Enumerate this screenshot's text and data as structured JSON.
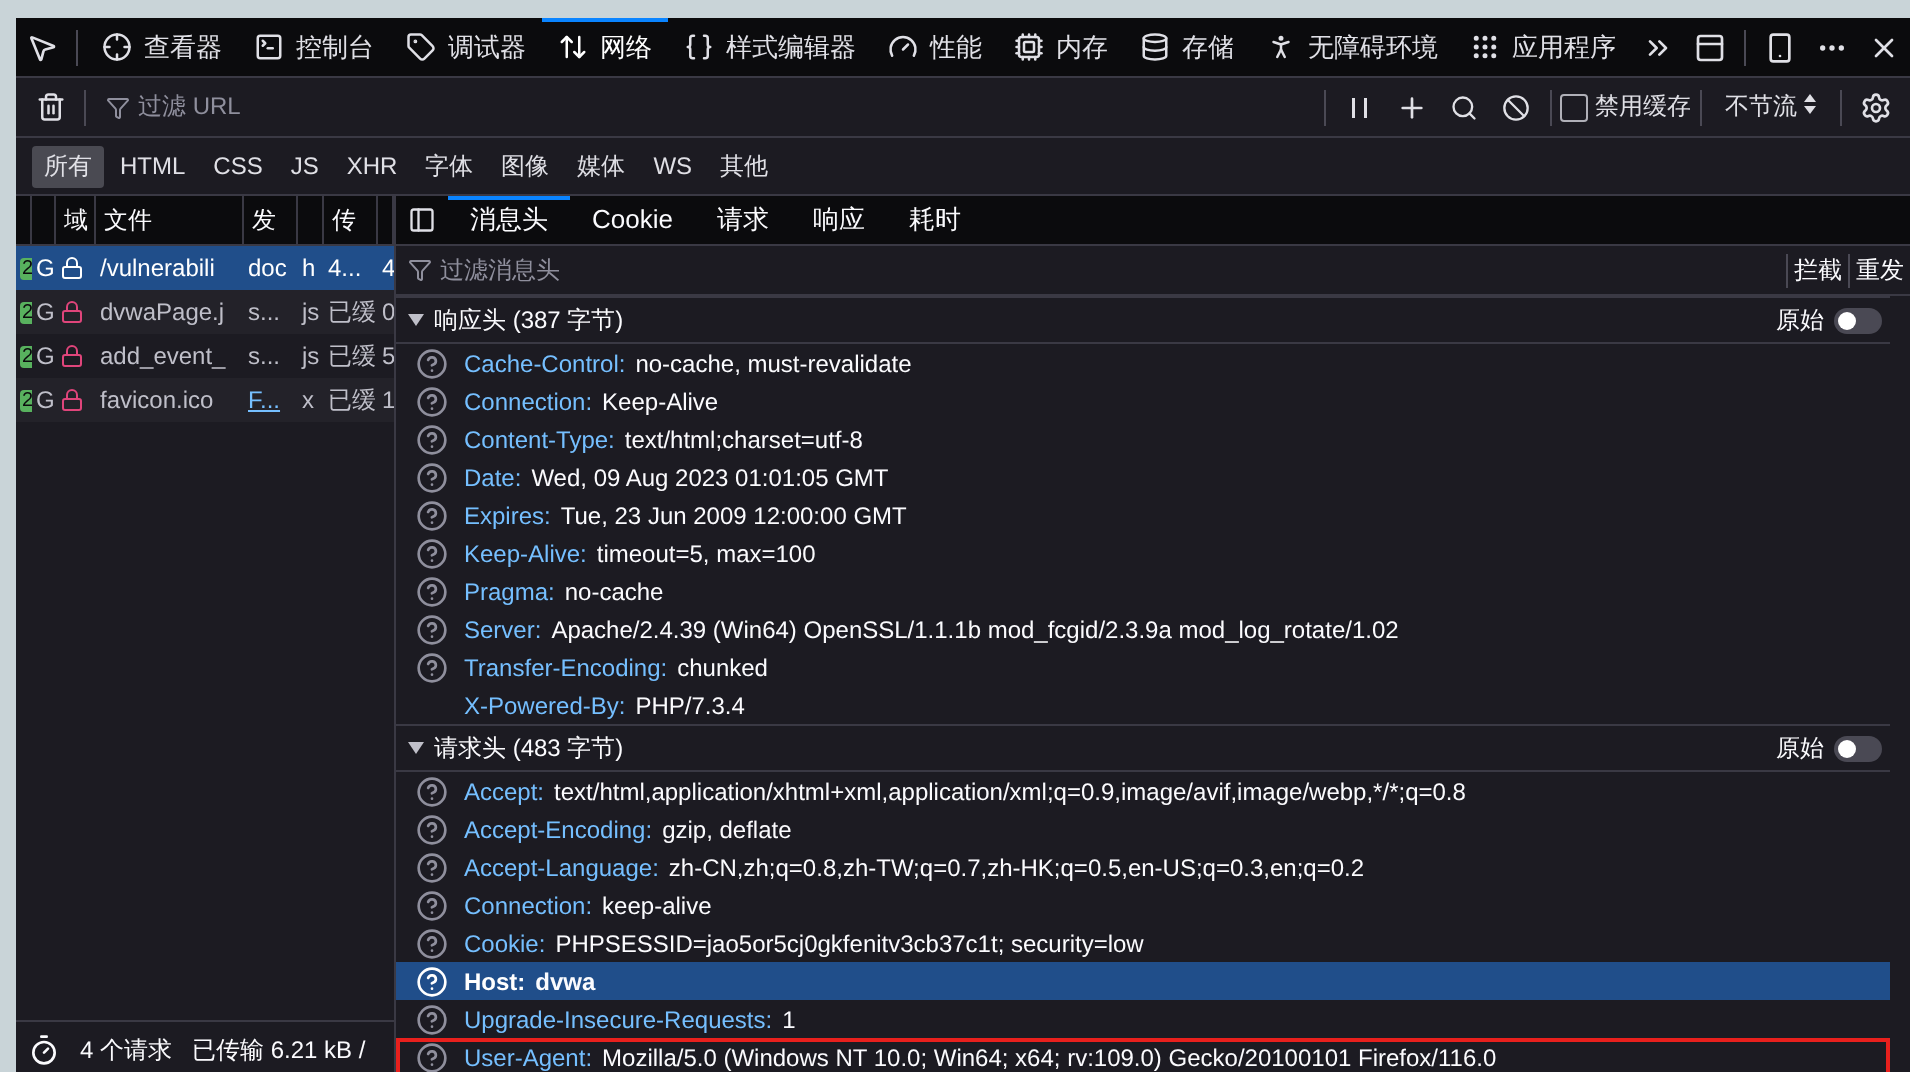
{
  "toolbar": {
    "tabs": [
      {
        "label": "查看器",
        "selected": false
      },
      {
        "label": "控制台",
        "selected": false
      },
      {
        "label": "调试器",
        "selected": false
      },
      {
        "label": "网络",
        "selected": true
      },
      {
        "label": "样式编辑器",
        "selected": false
      },
      {
        "label": "性能",
        "selected": false
      },
      {
        "label": "内存",
        "selected": false
      },
      {
        "label": "存储",
        "selected": false
      },
      {
        "label": "无障碍环境",
        "selected": false
      },
      {
        "label": "应用程序",
        "selected": false
      }
    ]
  },
  "network_toolbar": {
    "filter": {
      "placeholder": "过滤 URL"
    },
    "disable_cache": {
      "label": "禁用缓存",
      "checked": false
    },
    "throttle": "不节流"
  },
  "type_filters": [
    {
      "label": "所有",
      "selected": true
    },
    {
      "label": "HTML",
      "selected": false
    },
    {
      "label": "CSS",
      "selected": false
    },
    {
      "label": "JS",
      "selected": false
    },
    {
      "label": "XHR",
      "selected": false
    },
    {
      "label": "字体",
      "selected": false
    },
    {
      "label": "图像",
      "selected": false
    },
    {
      "label": "媒体",
      "selected": false
    },
    {
      "label": "WS",
      "selected": false
    },
    {
      "label": "其他",
      "selected": false
    }
  ],
  "requests": {
    "columns": [
      "域",
      "文件",
      "发",
      "传"
    ],
    "rows": [
      {
        "status": "2",
        "method": "G",
        "file": "/vulnerabili",
        "initiator": "doc",
        "initiator_link": false,
        "type": "h",
        "transferred": "4...",
        "size": "4",
        "selected": true
      },
      {
        "status": "2",
        "method": "G",
        "file": "dvwaPage.j",
        "initiator": "s...",
        "initiator_link": false,
        "type": "js",
        "transferred": "已缓",
        "size": "0",
        "selected": false
      },
      {
        "status": "2",
        "method": "G",
        "file": "add_event_",
        "initiator": "s...",
        "initiator_link": false,
        "type": "js",
        "transferred": "已缓",
        "size": "5",
        "selected": false
      },
      {
        "status": "2",
        "method": "G",
        "file": "favicon.ico",
        "initiator": "F...",
        "initiator_link": true,
        "type": "x",
        "transferred": "已缓",
        "size": "1",
        "selected": false
      }
    ]
  },
  "status_bar": {
    "requests": "4 个请求",
    "transferred": "已传输 6.21 kB /"
  },
  "details": {
    "tabs": [
      {
        "label": "消息头",
        "selected": true
      },
      {
        "label": "Cookie",
        "selected": false
      },
      {
        "label": "请求",
        "selected": false
      },
      {
        "label": "响应",
        "selected": false
      },
      {
        "label": "耗时",
        "selected": false
      }
    ],
    "filter": {
      "placeholder": "过滤消息头"
    },
    "actions": [
      "拦截",
      "重发"
    ],
    "sections": [
      {
        "title": "响应头 (387 字节)",
        "raw_label": "原始",
        "raw_on": false,
        "headers": [
          {
            "name": "Cache-Control:",
            "value": "no-cache, must-revalidate",
            "help": true,
            "selected": false,
            "highlighted": false
          },
          {
            "name": "Connection:",
            "value": "Keep-Alive",
            "help": true,
            "selected": false,
            "highlighted": false
          },
          {
            "name": "Content-Type:",
            "value": "text/html;charset=utf-8",
            "help": true,
            "selected": false,
            "highlighted": false
          },
          {
            "name": "Date:",
            "value": "Wed, 09 Aug 2023 01:01:05 GMT",
            "help": true,
            "selected": false,
            "highlighted": false
          },
          {
            "name": "Expires:",
            "value": "Tue, 23 Jun 2009 12:00:00 GMT",
            "help": true,
            "selected": false,
            "highlighted": false
          },
          {
            "name": "Keep-Alive:",
            "value": "timeout=5, max=100",
            "help": true,
            "selected": false,
            "highlighted": false
          },
          {
            "name": "Pragma:",
            "value": "no-cache",
            "help": true,
            "selected": false,
            "highlighted": false
          },
          {
            "name": "Server:",
            "value": "Apache/2.4.39 (Win64) OpenSSL/1.1.1b mod_fcgid/2.3.9a mod_log_rotate/1.02",
            "help": true,
            "selected": false,
            "highlighted": false
          },
          {
            "name": "Transfer-Encoding:",
            "value": "chunked",
            "help": true,
            "selected": false,
            "highlighted": false
          },
          {
            "name": "X-Powered-By:",
            "value": "PHP/7.3.4",
            "help": false,
            "selected": false,
            "highlighted": false
          }
        ]
      },
      {
        "title": "请求头 (483 字节)",
        "raw_label": "原始",
        "raw_on": false,
        "headers": [
          {
            "name": "Accept:",
            "value": "text/html,application/xhtml+xml,application/xml;q=0.9,image/avif,image/webp,*/*;q=0.8",
            "help": true,
            "selected": false,
            "highlighted": false
          },
          {
            "name": "Accept-Encoding:",
            "value": "gzip, deflate",
            "help": true,
            "selected": false,
            "highlighted": false
          },
          {
            "name": "Accept-Language:",
            "value": "zh-CN,zh;q=0.8,zh-TW;q=0.7,zh-HK;q=0.5,en-US;q=0.3,en;q=0.2",
            "help": true,
            "selected": false,
            "highlighted": false
          },
          {
            "name": "Connection:",
            "value": "keep-alive",
            "help": true,
            "selected": false,
            "highlighted": false
          },
          {
            "name": "Cookie:",
            "value": "PHPSESSID=jao5or5cj0gkfenitv3cb37c1t; security=low",
            "help": true,
            "selected": false,
            "highlighted": false
          },
          {
            "name": "Host:",
            "value": "dvwa",
            "help": true,
            "selected": true,
            "highlighted": false
          },
          {
            "name": "Upgrade-Insecure-Requests:",
            "value": "1",
            "help": true,
            "selected": false,
            "highlighted": false
          },
          {
            "name": "User-Agent:",
            "value": "Mozilla/5.0 (Windows NT 10.0; Win64; x64; rv:109.0) Gecko/20100101 Firefox/116.0",
            "help": true,
            "selected": false,
            "highlighted": true
          }
        ]
      }
    ]
  }
}
